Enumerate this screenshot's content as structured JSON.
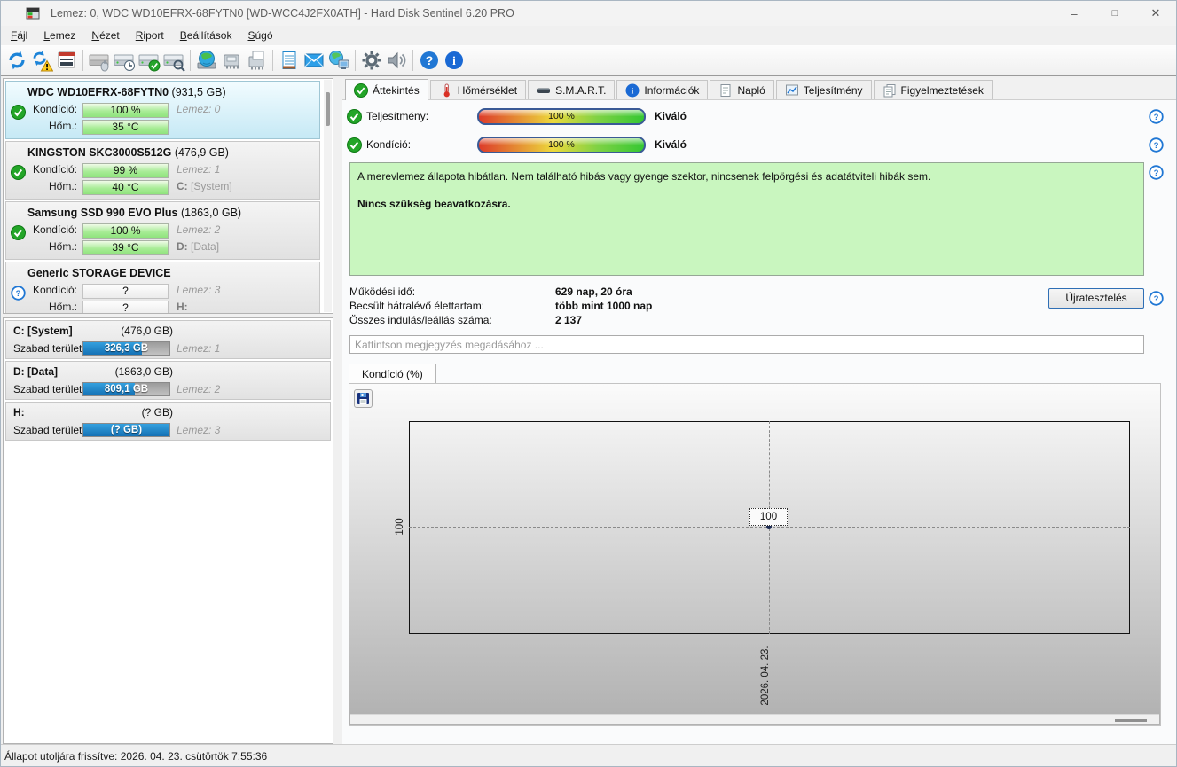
{
  "window": {
    "title": "Lemez: 0, WDC WD10EFRX-68FYTN0 [WD-WCC4J2FX0ATH]  -  Hard Disk Sentinel 6.20 PRO",
    "controls": {
      "minimize": "–",
      "maximize": "□",
      "close": "✕"
    }
  },
  "menu": {
    "items": [
      "Fájl",
      "Lemez",
      "Nézet",
      "Riport",
      "Beállítások",
      "Súgó"
    ]
  },
  "toolbar": {
    "icons": [
      "refresh",
      "refresh-warning",
      "report",
      "disk-offline",
      "disk-schedule",
      "disk-accept",
      "disk-surface-test",
      "network-disks",
      "safely-remove-hardware",
      "eject-hardware",
      "notes",
      "email",
      "network-status",
      "settings",
      "sounds",
      "help",
      "information"
    ]
  },
  "sidebar": {
    "labels": {
      "condition": "Kondíció:",
      "temperature": "Hőm.:",
      "free_space": "Szabad terület"
    },
    "disks": [
      {
        "name": "WDC WD10EFRX-68FYTN0",
        "size": "(931,5 GB)",
        "condition": "100 %",
        "temperature": "35 °C",
        "disk_label": "Lemez: 0",
        "volume_letter": "",
        "volume_name": "",
        "status": "ok",
        "selected": true
      },
      {
        "name": "KINGSTON SKC3000S512G",
        "size": "(476,9 GB)",
        "condition": "99 %",
        "temperature": "40 °C",
        "disk_label": "Lemez: 1",
        "volume_letter": "C:",
        "volume_name": "[System]",
        "status": "ok",
        "selected": false
      },
      {
        "name": "Samsung SSD 990 EVO Plus",
        "size": "(1863,0 GB)",
        "condition": "100 %",
        "temperature": "39 °C",
        "disk_label": "Lemez: 2",
        "volume_letter": "D:",
        "volume_name": "[Data]",
        "status": "ok",
        "selected": false
      },
      {
        "name": "Generic STORAGE DEVICE",
        "size": "",
        "condition": "?",
        "temperature": "?",
        "disk_label": "Lemez: 3",
        "volume_letter": "H:",
        "volume_name": "",
        "status": "unknown",
        "selected": false
      }
    ],
    "partitions": [
      {
        "name": "C: [System]",
        "size": "(476,0 GB)",
        "free": "326,3 GB",
        "free_pct": 68,
        "disk_label": "Lemez: 1"
      },
      {
        "name": "D: [Data]",
        "size": "(1863,0 GB)",
        "free": "809,1 GB",
        "free_pct": 60,
        "disk_label": "Lemez: 2"
      },
      {
        "name": "H:",
        "size": "(? GB)",
        "free": "(? GB)",
        "free_pct": 100,
        "disk_label": "Lemez: 3"
      }
    ]
  },
  "tabs": [
    {
      "label": "Áttekintés",
      "icon": "check-circle",
      "active": true
    },
    {
      "label": "Hőmérséklet",
      "icon": "thermometer",
      "active": false
    },
    {
      "label": "S.M.A.R.T.",
      "icon": "disk",
      "active": false
    },
    {
      "label": "Információk",
      "icon": "info-circle",
      "active": false
    },
    {
      "label": "Napló",
      "icon": "document",
      "active": false
    },
    {
      "label": "Teljesítmény",
      "icon": "chart",
      "active": false
    },
    {
      "label": "Figyelmeztetések",
      "icon": "pages",
      "active": false
    }
  ],
  "overview": {
    "performance_label": "Teljesítmény:",
    "performance_value": "100 %",
    "performance_rating": "Kiváló",
    "condition_label": "Kondíció:",
    "condition_value": "100 %",
    "condition_rating": "Kiváló",
    "status_text": "A merevlemez állapota hibátlan. Nem található hibás vagy gyenge szektor, nincsenek felpörgési és adatátviteli hibák sem.",
    "status_action": "Nincs szükség beavatkozásra.",
    "stats": [
      {
        "label": "Működési idő:",
        "value": "629 nap, 20 óra"
      },
      {
        "label": "Becsült hátralévő élettartam:",
        "value": "több mint 1000 nap"
      },
      {
        "label": "Összes indulás/leállás száma:",
        "value": "2 137"
      }
    ],
    "retest_button": "Újratesztelés",
    "comment_placeholder": "Kattintson megjegyzés megadásához ..."
  },
  "chart_data": {
    "type": "line",
    "title": "Kondíció  (%)",
    "x": [
      "2026. 04. 23."
    ],
    "series": [
      {
        "name": "Kondíció",
        "values": [
          100
        ]
      }
    ],
    "point_label": "100",
    "y_ticks": [
      "100"
    ],
    "x_ticks": [
      "2026. 04. 23."
    ],
    "grid": "dashed-crosshair",
    "legend": "none"
  },
  "status_bar": {
    "text": "Állapot utoljára frissítve: 2026. 04. 23. csütörtök 7:55:36"
  }
}
